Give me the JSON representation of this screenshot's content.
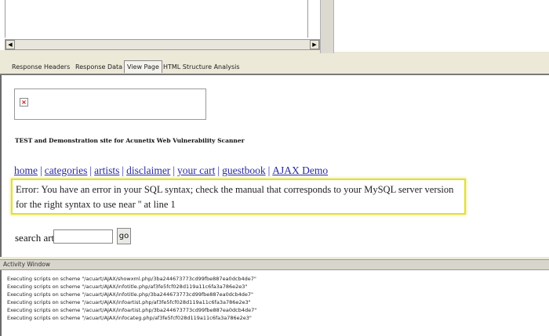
{
  "tabs": [
    {
      "label": "Response Headers"
    },
    {
      "label": "Response Data"
    },
    {
      "label": "View Page"
    },
    {
      "label": "HTML Structure Analysis"
    }
  ],
  "page": {
    "broken_image_glyph": "×",
    "site_title": "TEST and Demonstration site for Acunetix Web Vulnerability Scanner",
    "nav": [
      {
        "label": "home"
      },
      {
        "label": "categories"
      },
      {
        "label": "artists"
      },
      {
        "label": "disclaimer"
      },
      {
        "label": "your cart"
      },
      {
        "label": "guestbook"
      },
      {
        "label": "AJAX Demo"
      }
    ],
    "nav_separator": "|",
    "error_message": "Error: You have an error in your SQL syntax; check the manual that corresponds to your MySQL server version for the right syntax to use near '' at line 1",
    "search_label": "search art",
    "search_value": "",
    "go_label": "go"
  },
  "activity": {
    "title": "Activity Window",
    "lines": [
      "Executing scripts on scheme \"/acuart/AJAX/showxml.php/3ba244673773cd99fbe887ea0dcb4de7\"",
      "Executing scripts on scheme \"/acuart/AJAX/infotitle.php/af3fe5fcf028d119a11c6fa3a786e2e3\"",
      "Executing scripts on scheme \"/acuart/AJAX/infotitle.php/3ba244673773cd99fbe887ea0dcb4de7\"",
      "Executing scripts on scheme \"/acuart/AJAX/infoartist.php/af3fe5fcf028d119a11c6fa3a786e2e3\"",
      "Executing scripts on scheme \"/acuart/AJAX/infoartist.php/3ba244673773cd99fbe887ea0dcb4de7\"",
      "Executing scripts on scheme \"/acuart/AJAX/infocateg.php/af3fe5fcf028d119a11c6fa3a786e2e3\""
    ]
  },
  "colors": {
    "link": "#2a2aa0",
    "highlight_border": "#e0df3a",
    "chrome": "#ece9d8"
  }
}
